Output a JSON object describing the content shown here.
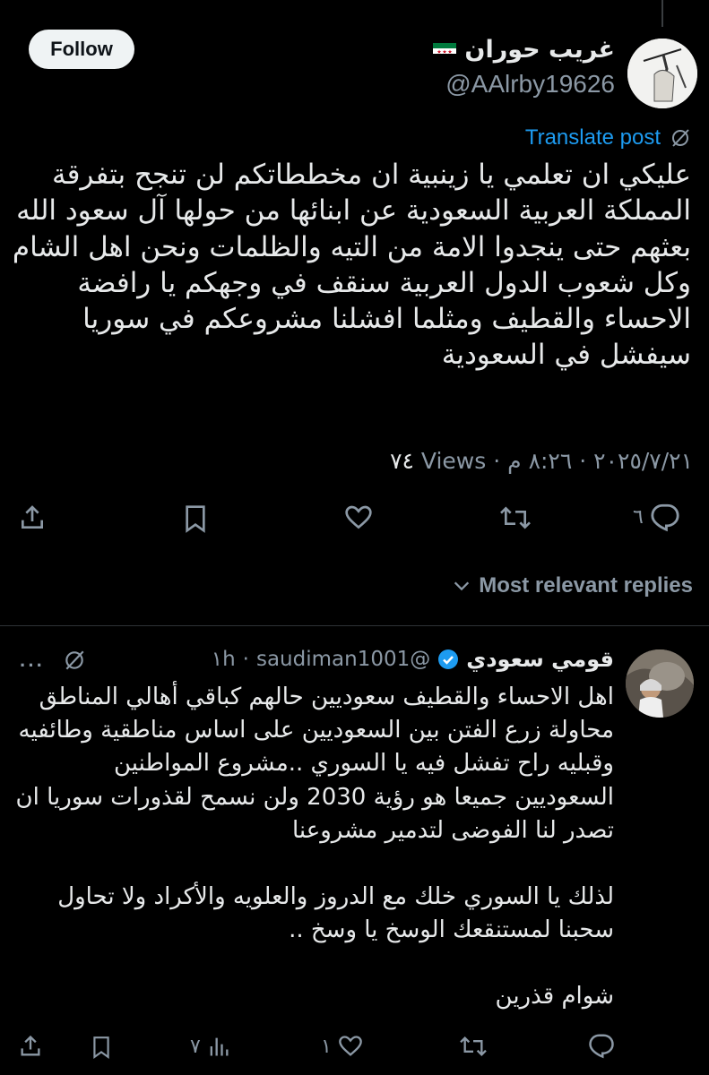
{
  "post": {
    "follow_label": "Follow",
    "author_name": "غريب حوران",
    "handle": "@AAlrby19626",
    "translate_label": "Translate post",
    "text": "عليكي ان تعلمي يا زينبية ان مخططاتكم لن تنجح بتفرقة المملكة العربية السعودية عن ابنائها من حولها آل سعود الله بعثهم حتى ينجدوا الامة من التيه والظلمات ونحن اهل الشام وكل شعوب الدول العربية سنقف في وجهكم يا رافضة الاحساء والقطيف ومثلما افشلنا مشروعكم في سوريا سيفشل في السعودية",
    "date": "٢٠٢٥/٧/٢١",
    "time": "٨:٢٦ م",
    "views_count": "٧٤",
    "views_label": "Views",
    "reply_count": "٦"
  },
  "replies_filter": "Most relevant replies",
  "reply": {
    "author_name": "قومي سعودي",
    "handle": "@saudiman1001",
    "time": "١h",
    "paragraphs": [
      "اهل الاحساء والقطيف سعوديين حالهم كباقي أهالي المناطق محاولة زرع الفتن بين السعوديين على اساس مناطقية وطائفيه وقبليه راح تفشل فيه يا السوري ..مشروع المواطنين السعوديين جميعا هو رؤية 2030 ولن نسمح لقذورات سوريا ان تصدر لنا الفوضى لتدمير مشروعنا",
      "لذلك يا السوري خلك مع الدروز والعلويه والأكراد ولا تحاول سحبنا لمستنقعك الوسخ يا وسخ ..",
      "شوام قذرين"
    ],
    "like_count": "١",
    "views_count": "٧",
    "more_label": "···"
  },
  "colors": {
    "accent": "#1d9bf0",
    "muted": "#8b98a5",
    "text": "#e7e9ea",
    "bg": "#000000",
    "verified": "#1d9bf0"
  },
  "icons": [
    "share-icon",
    "bookmark-icon",
    "like-icon",
    "repost-icon",
    "reply-icon",
    "translate-icon",
    "chevron-down-icon",
    "verified-icon",
    "grok-icon",
    "views-icon",
    "more-icon"
  ]
}
